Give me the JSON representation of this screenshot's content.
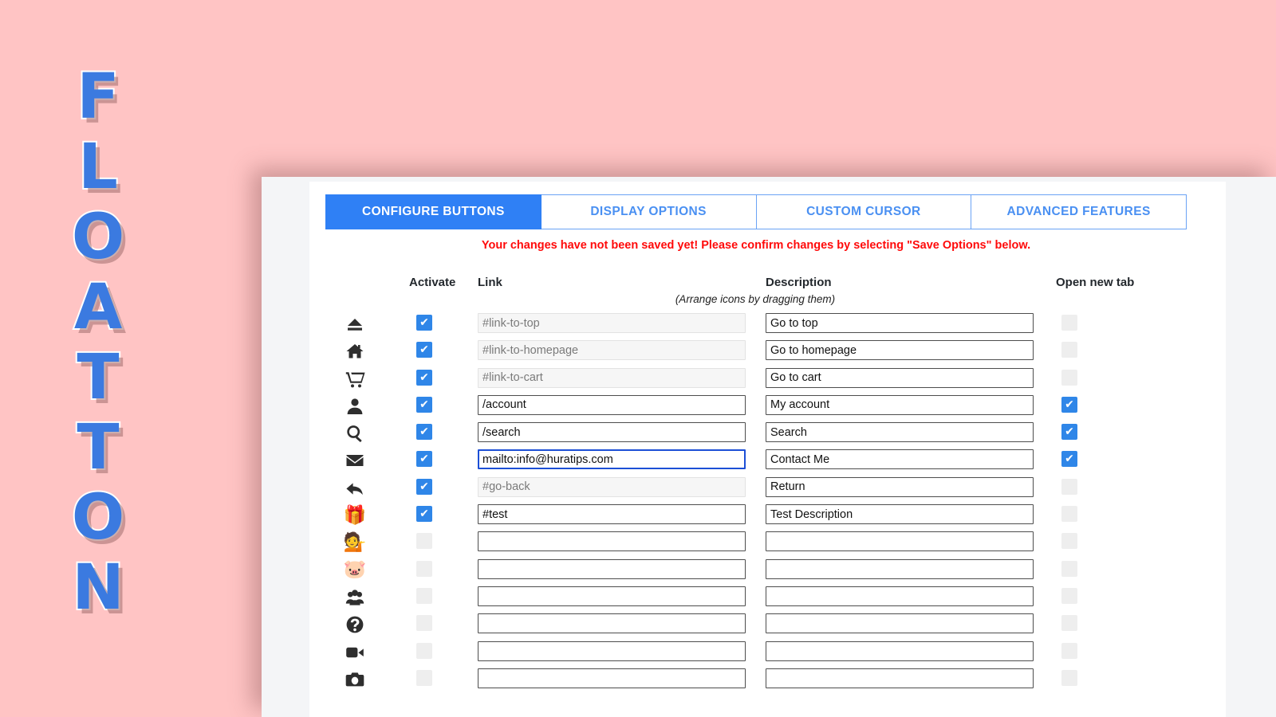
{
  "brand": {
    "name": "FLOATTON",
    "letters": [
      "F",
      "L",
      "O",
      "A",
      "T",
      "T",
      "O",
      "N"
    ],
    "color": "#3b7ae0"
  },
  "page_background": "#ffc4c4",
  "tabs": [
    {
      "label": "CONFIGURE BUTTONS",
      "active": true
    },
    {
      "label": "DISPLAY OPTIONS",
      "active": false
    },
    {
      "label": "CUSTOM CURSOR",
      "active": false
    },
    {
      "label": "ADVANCED FEATURES",
      "active": false
    }
  ],
  "notice": {
    "text": "Your changes have not been saved yet! Please confirm changes by selecting \"Save Options\" below.",
    "color": "#ff0a0a"
  },
  "table": {
    "headers": {
      "activate": "Activate",
      "link": "Link",
      "description": "Description",
      "open_new_tab": "Open new tab"
    },
    "hint": "(Arrange icons by dragging them)",
    "rows": [
      {
        "icon": "eject-icon",
        "activate": true,
        "link": "#link-to-top",
        "link_disabled": true,
        "link_focused": false,
        "description": "Go to top",
        "desc_disabled": false,
        "new_tab": false
      },
      {
        "icon": "home-icon",
        "activate": true,
        "link": "#link-to-homepage",
        "link_disabled": true,
        "link_focused": false,
        "description": "Go to homepage",
        "desc_disabled": false,
        "new_tab": false
      },
      {
        "icon": "cart-icon",
        "activate": true,
        "link": "#link-to-cart",
        "link_disabled": true,
        "link_focused": false,
        "description": "Go to cart",
        "desc_disabled": false,
        "new_tab": false
      },
      {
        "icon": "user-icon",
        "activate": true,
        "link": "/account",
        "link_disabled": false,
        "link_focused": false,
        "description": "My account",
        "desc_disabled": false,
        "new_tab": true
      },
      {
        "icon": "search-icon",
        "activate": true,
        "link": "/search",
        "link_disabled": false,
        "link_focused": false,
        "description": "Search",
        "desc_disabled": false,
        "new_tab": true
      },
      {
        "icon": "envelope-icon",
        "activate": true,
        "link": "mailto:info@huratips.com",
        "link_disabled": false,
        "link_focused": true,
        "description": "Contact Me",
        "desc_disabled": false,
        "new_tab": true
      },
      {
        "icon": "back-arrow-icon",
        "activate": true,
        "link": "#go-back",
        "link_disabled": true,
        "link_focused": false,
        "description": "Return",
        "desc_disabled": false,
        "new_tab": false
      },
      {
        "icon": "gift-icon",
        "activate": true,
        "link": "#test",
        "link_disabled": false,
        "link_focused": false,
        "description": "Test Description",
        "desc_disabled": false,
        "new_tab": false
      },
      {
        "icon": "support-agent-icon",
        "activate": false,
        "link": "",
        "link_disabled": false,
        "link_focused": false,
        "description": "",
        "desc_disabled": false,
        "new_tab": false
      },
      {
        "icon": "piggy-bank-icon",
        "activate": false,
        "link": "",
        "link_disabled": false,
        "link_focused": false,
        "description": "",
        "desc_disabled": false,
        "new_tab": false
      },
      {
        "icon": "group-icon",
        "activate": false,
        "link": "",
        "link_disabled": false,
        "link_focused": false,
        "description": "",
        "desc_disabled": false,
        "new_tab": false
      },
      {
        "icon": "question-icon",
        "activate": false,
        "link": "",
        "link_disabled": false,
        "link_focused": false,
        "description": "",
        "desc_disabled": false,
        "new_tab": false
      },
      {
        "icon": "video-icon",
        "activate": false,
        "link": "",
        "link_disabled": false,
        "link_focused": false,
        "description": "",
        "desc_disabled": false,
        "new_tab": false
      },
      {
        "icon": "camera-icon",
        "activate": false,
        "link": "",
        "link_disabled": false,
        "link_focused": false,
        "description": "",
        "desc_disabled": false,
        "new_tab": false
      }
    ]
  },
  "checkbox_colors": {
    "checked": "#2f86e8",
    "unchecked": "#eeeeee",
    "tick": "✔"
  }
}
